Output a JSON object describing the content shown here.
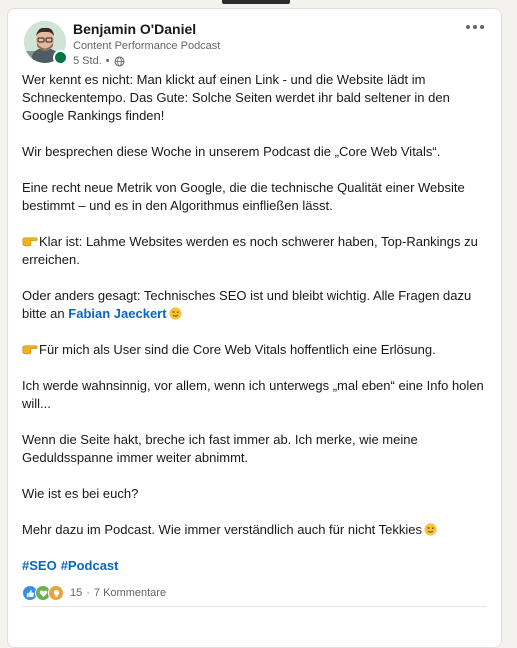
{
  "post": {
    "author": {
      "name": "Benjamin O'Daniel",
      "headline": "Content Performance Podcast",
      "time": "5 Std.",
      "visibility_icon": "globe-icon",
      "online": true
    },
    "more_icon": "ellipsis-icon",
    "paragraphs": [
      "Wer kennt es nicht: Man klickt auf einen Link - und die Website lädt im Schneckentempo. Das Gute: Solche Seiten werdet ihr bald seltener in den Google Rankings finden!",
      "Wir besprechen diese Woche in unserem Podcast die „Core Web Vitals“.",
      "Eine recht neue Metrik von Google, die die technische Qualität einer Website bestimmt – und es in den Algorithmus einfließen lässt.",
      "Klar ist: Lahme Websites werden es noch schwerer haben, Top-Rankings zu erreichen.",
      "Oder anders gesagt: Technisches SEO ist und bleibt wichtig. Alle Fragen dazu bitte an",
      "Für mich als User sind die Core Web Vitals hoffentlich eine Erlösung.",
      "Ich werde wahnsinnig, vor allem, wenn ich unterwegs „mal eben“ eine Info holen will...",
      "Wenn die Seite hakt, breche ich fast immer ab. Ich merke, wie meine Geduldsspanne immer weiter abnimmt.",
      "Wie ist es bei euch?",
      "Mehr dazu im Podcast. Wie immer verständlich auch für nicht Tekkies"
    ],
    "mention": "Fabian Jaeckert",
    "hashtags": [
      "#SEO",
      "#Podcast"
    ],
    "social": {
      "reaction_icons": [
        "like-icon",
        "support-icon",
        "insightful-icon"
      ],
      "reaction_count": "15",
      "separator": "·",
      "comments": "7 Kommentare"
    }
  },
  "colors": {
    "link": "#0a66c2",
    "text": "#191919",
    "secondary": "#666666",
    "online": "#057642",
    "background": "#f3f2ef"
  }
}
